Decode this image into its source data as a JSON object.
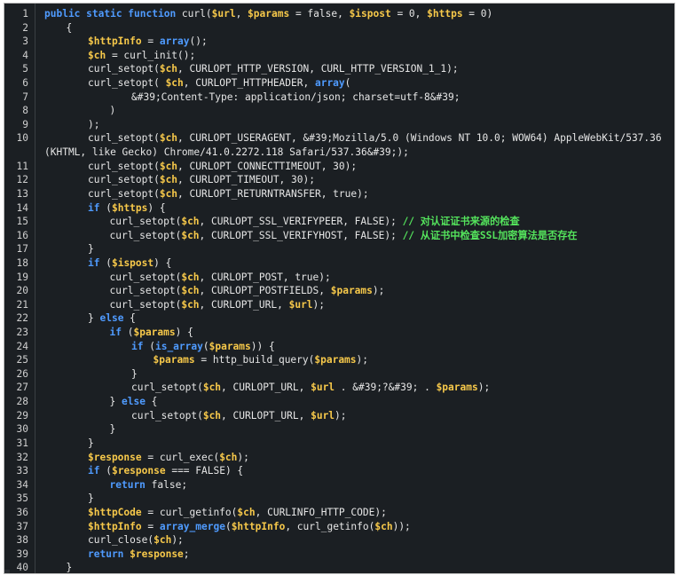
{
  "editor": {
    "lines": [
      {
        "n": "1",
        "indent": 0,
        "tokens": [
          [
            "kw",
            "public static function "
          ],
          [
            "p",
            "curl("
          ],
          [
            "var",
            "$url"
          ],
          [
            "p",
            ", "
          ],
          [
            "var",
            "$params"
          ],
          [
            "p",
            " = false, "
          ],
          [
            "var",
            "$ispost"
          ],
          [
            "p",
            " = 0, "
          ],
          [
            "var",
            "$https"
          ],
          [
            "p",
            " = 0)"
          ]
        ]
      },
      {
        "n": "2",
        "indent": 1,
        "tokens": [
          [
            "p",
            "{"
          ]
        ]
      },
      {
        "n": "3",
        "indent": 2,
        "tokens": [
          [
            "var",
            "$httpInfo"
          ],
          [
            "p",
            " = "
          ],
          [
            "fn",
            "array"
          ],
          [
            "p",
            "();"
          ]
        ]
      },
      {
        "n": "4",
        "indent": 2,
        "tokens": [
          [
            "var",
            "$ch"
          ],
          [
            "p",
            " = curl_init();"
          ]
        ]
      },
      {
        "n": "5",
        "indent": 2,
        "tokens": [
          [
            "p",
            "curl_setopt("
          ],
          [
            "var",
            "$ch"
          ],
          [
            "p",
            ", CURLOPT_HTTP_VERSION, CURL_HTTP_VERSION_1_1);"
          ]
        ]
      },
      {
        "n": "6",
        "indent": 2,
        "tokens": [
          [
            "p",
            "curl_setopt( "
          ],
          [
            "var",
            "$ch"
          ],
          [
            "p",
            ", CURLOPT_HTTPHEADER, "
          ],
          [
            "fn",
            "array"
          ],
          [
            "p",
            "("
          ]
        ]
      },
      {
        "n": "7",
        "indent": 4,
        "tokens": [
          [
            "p",
            "&#39;Content-Type: application/json; charset=utf-8&#39;"
          ]
        ]
      },
      {
        "n": "8",
        "indent": 3,
        "tokens": [
          [
            "p",
            ")"
          ]
        ]
      },
      {
        "n": "9",
        "indent": 2,
        "tokens": [
          [
            "p",
            ");"
          ]
        ]
      },
      {
        "n": "10",
        "indent": 2,
        "wrap": true,
        "tokens": [
          [
            "p",
            "curl_setopt("
          ],
          [
            "var",
            "$ch"
          ],
          [
            "p",
            ", CURLOPT_USERAGENT, &#39;Mozilla/5.0 (Windows NT 10.0; WOW64) AppleWebKit/537.36 (KHTML, like Gecko) Chrome/41.0.2272.118 Safari/537.36&#39;);"
          ]
        ]
      },
      {
        "n": "11",
        "indent": 2,
        "tokens": [
          [
            "p",
            "curl_setopt("
          ],
          [
            "var",
            "$ch"
          ],
          [
            "p",
            ", CURLOPT_CONNECTTIMEOUT, 30);"
          ]
        ]
      },
      {
        "n": "12",
        "indent": 2,
        "tokens": [
          [
            "p",
            "curl_setopt("
          ],
          [
            "var",
            "$ch"
          ],
          [
            "p",
            ", CURLOPT_TIMEOUT, 30);"
          ]
        ]
      },
      {
        "n": "13",
        "indent": 2,
        "tokens": [
          [
            "p",
            "curl_setopt("
          ],
          [
            "var",
            "$ch"
          ],
          [
            "p",
            ", CURLOPT_RETURNTRANSFER, true);"
          ]
        ]
      },
      {
        "n": "14",
        "indent": 2,
        "tokens": [
          [
            "kw",
            "if"
          ],
          [
            "p",
            " ("
          ],
          [
            "var",
            "$https"
          ],
          [
            "p",
            ") {"
          ]
        ]
      },
      {
        "n": "15",
        "indent": 3,
        "tokens": [
          [
            "p",
            "curl_setopt("
          ],
          [
            "var",
            "$ch"
          ],
          [
            "p",
            ", CURLOPT_SSL_VERIFYPEER, FALSE); "
          ],
          [
            "cmt",
            "// 对认证证书来源的检查"
          ]
        ]
      },
      {
        "n": "16",
        "indent": 3,
        "tokens": [
          [
            "p",
            "curl_setopt("
          ],
          [
            "var",
            "$ch"
          ],
          [
            "p",
            ", CURLOPT_SSL_VERIFYHOST, FALSE); "
          ],
          [
            "cmt",
            "// 从证书中检查SSL加密算法是否存在"
          ]
        ]
      },
      {
        "n": "17",
        "indent": 2,
        "tokens": [
          [
            "p",
            "}"
          ]
        ]
      },
      {
        "n": "18",
        "indent": 2,
        "tokens": [
          [
            "kw",
            "if"
          ],
          [
            "p",
            " ("
          ],
          [
            "var",
            "$ispost"
          ],
          [
            "p",
            ") {"
          ]
        ]
      },
      {
        "n": "19",
        "indent": 3,
        "tokens": [
          [
            "p",
            "curl_setopt("
          ],
          [
            "var",
            "$ch"
          ],
          [
            "p",
            ", CURLOPT_POST, true);"
          ]
        ]
      },
      {
        "n": "20",
        "indent": 3,
        "tokens": [
          [
            "p",
            "curl_setopt("
          ],
          [
            "var",
            "$ch"
          ],
          [
            "p",
            ", CURLOPT_POSTFIELDS, "
          ],
          [
            "var",
            "$params"
          ],
          [
            "p",
            ");"
          ]
        ]
      },
      {
        "n": "21",
        "indent": 3,
        "tokens": [
          [
            "p",
            "curl_setopt("
          ],
          [
            "var",
            "$ch"
          ],
          [
            "p",
            ", CURLOPT_URL, "
          ],
          [
            "var",
            "$url"
          ],
          [
            "p",
            ");"
          ]
        ]
      },
      {
        "n": "22",
        "indent": 2,
        "tokens": [
          [
            "p",
            "} "
          ],
          [
            "kw",
            "else"
          ],
          [
            "p",
            " {"
          ]
        ]
      },
      {
        "n": "23",
        "indent": 3,
        "tokens": [
          [
            "kw",
            "if"
          ],
          [
            "p",
            " ("
          ],
          [
            "var",
            "$params"
          ],
          [
            "p",
            ") {"
          ]
        ]
      },
      {
        "n": "24",
        "indent": 4,
        "tokens": [
          [
            "kw",
            "if"
          ],
          [
            "p",
            " ("
          ],
          [
            "fn",
            "is_array"
          ],
          [
            "p",
            "("
          ],
          [
            "var",
            "$params"
          ],
          [
            "p",
            ")) {"
          ]
        ]
      },
      {
        "n": "25",
        "indent": 5,
        "tokens": [
          [
            "var",
            "$params"
          ],
          [
            "p",
            " = http_build_query("
          ],
          [
            "var",
            "$params"
          ],
          [
            "p",
            ");"
          ]
        ]
      },
      {
        "n": "26",
        "indent": 4,
        "tokens": [
          [
            "p",
            "}"
          ]
        ]
      },
      {
        "n": "27",
        "indent": 4,
        "tokens": [
          [
            "p",
            "curl_setopt("
          ],
          [
            "var",
            "$ch"
          ],
          [
            "p",
            ", CURLOPT_URL, "
          ],
          [
            "var",
            "$url"
          ],
          [
            "p",
            " . &#39;?&#39; . "
          ],
          [
            "var",
            "$params"
          ],
          [
            "p",
            ");"
          ]
        ]
      },
      {
        "n": "28",
        "indent": 3,
        "tokens": [
          [
            "p",
            "} "
          ],
          [
            "kw",
            "else"
          ],
          [
            "p",
            " {"
          ]
        ]
      },
      {
        "n": "29",
        "indent": 4,
        "tokens": [
          [
            "p",
            "curl_setopt("
          ],
          [
            "var",
            "$ch"
          ],
          [
            "p",
            ", CURLOPT_URL, "
          ],
          [
            "var",
            "$url"
          ],
          [
            "p",
            ");"
          ]
        ]
      },
      {
        "n": "30",
        "indent": 3,
        "tokens": [
          [
            "p",
            "}"
          ]
        ]
      },
      {
        "n": "31",
        "indent": 2,
        "tokens": [
          [
            "p",
            "}"
          ]
        ]
      },
      {
        "n": "32",
        "indent": 2,
        "tokens": [
          [
            "var",
            "$response"
          ],
          [
            "p",
            " = curl_exec("
          ],
          [
            "var",
            "$ch"
          ],
          [
            "p",
            ");"
          ]
        ]
      },
      {
        "n": "33",
        "indent": 2,
        "tokens": [
          [
            "kw",
            "if"
          ],
          [
            "p",
            " ("
          ],
          [
            "var",
            "$response"
          ],
          [
            "p",
            " === FALSE) {"
          ]
        ]
      },
      {
        "n": "34",
        "indent": 3,
        "tokens": [
          [
            "kw",
            "return"
          ],
          [
            "p",
            " false;"
          ]
        ]
      },
      {
        "n": "35",
        "indent": 2,
        "tokens": [
          [
            "p",
            "}"
          ]
        ]
      },
      {
        "n": "36",
        "indent": 2,
        "tokens": [
          [
            "var",
            "$httpCode"
          ],
          [
            "p",
            " = curl_getinfo("
          ],
          [
            "var",
            "$ch"
          ],
          [
            "p",
            ", CURLINFO_HTTP_CODE);"
          ]
        ]
      },
      {
        "n": "37",
        "indent": 2,
        "tokens": [
          [
            "var",
            "$httpInfo"
          ],
          [
            "p",
            " = "
          ],
          [
            "fn",
            "array_merge"
          ],
          [
            "p",
            "("
          ],
          [
            "var",
            "$httpInfo"
          ],
          [
            "p",
            ", curl_getinfo("
          ],
          [
            "var",
            "$ch"
          ],
          [
            "p",
            "));"
          ]
        ]
      },
      {
        "n": "38",
        "indent": 2,
        "tokens": [
          [
            "p",
            "curl_close("
          ],
          [
            "var",
            "$ch"
          ],
          [
            "p",
            ");"
          ]
        ]
      },
      {
        "n": "39",
        "indent": 2,
        "tokens": [
          [
            "kw",
            "return"
          ],
          [
            "p",
            " "
          ],
          [
            "var",
            "$response"
          ],
          [
            "p",
            ";"
          ]
        ]
      },
      {
        "n": "40",
        "indent": 1,
        "tokens": [
          [
            "p",
            "}"
          ]
        ]
      }
    ]
  }
}
